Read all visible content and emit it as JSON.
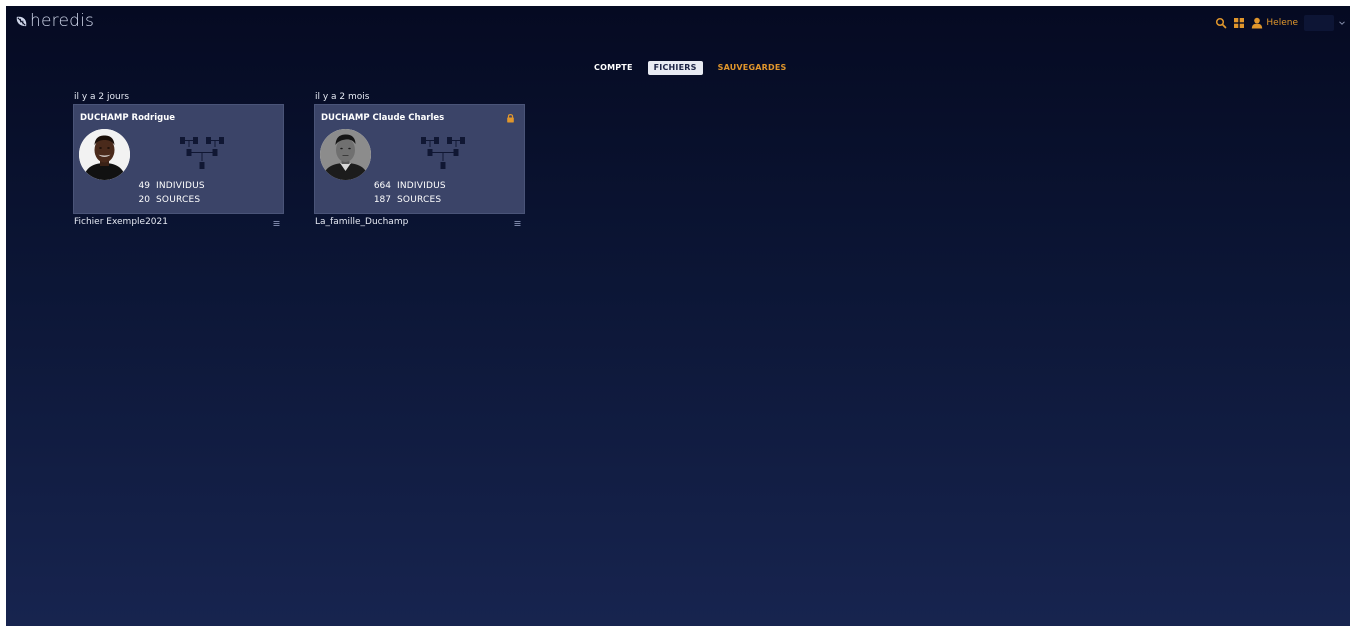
{
  "app": {
    "logo_text": "heredis"
  },
  "header": {
    "user_name": "Helene",
    "accent_color": "#e0962c"
  },
  "tabs": [
    {
      "label": "COMPTE",
      "state": "normal"
    },
    {
      "label": "FICHIERS",
      "state": "selected"
    },
    {
      "label": "SAUVEGARDES",
      "state": "highlight"
    }
  ],
  "files": [
    {
      "date": "il y a 2 jours",
      "person": "DUCHAMP Rodrigue",
      "locked": false,
      "individus_count": "49",
      "individus_label": "INDIVIDUS",
      "sources_count": "20",
      "sources_label": "SOURCES",
      "file_name": "Fichier Exemple2021"
    },
    {
      "date": "il y a 2 mois",
      "person": "DUCHAMP Claude Charles",
      "locked": true,
      "individus_count": "664",
      "individus_label": "INDIVIDUS",
      "sources_count": "187",
      "sources_label": "SOURCES",
      "file_name": "La_famille_Duchamp"
    }
  ],
  "icons": {
    "search": "search-icon",
    "apps": "grid-icon",
    "user": "user-icon",
    "chevron": "chevron-down-icon",
    "lock": "lock-icon",
    "tree": "family-tree-icon",
    "menu": "menu-icon"
  }
}
